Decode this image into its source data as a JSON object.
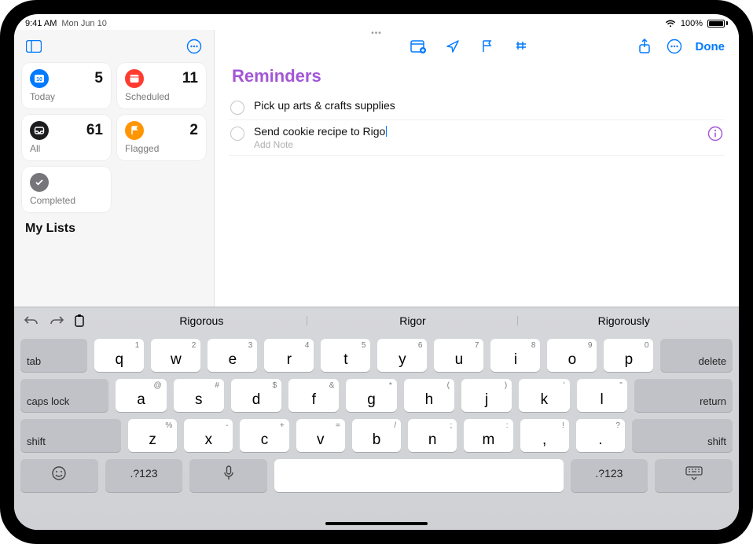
{
  "status": {
    "time": "9:41 AM",
    "date": "Mon Jun 10",
    "battery_percent": "100%"
  },
  "sidebar": {
    "cards": {
      "today": {
        "label": "Today",
        "count": "5"
      },
      "scheduled": {
        "label": "Scheduled",
        "count": "11"
      },
      "all": {
        "label": "All",
        "count": "61"
      },
      "flagged": {
        "label": "Flagged",
        "count": "2"
      },
      "completed": {
        "label": "Completed"
      }
    },
    "my_lists_heading": "My Lists"
  },
  "main": {
    "title": "Reminders",
    "done_label": "Done",
    "reminders": [
      {
        "text": "Pick up arts & crafts supplies"
      },
      {
        "text": "Send cookie recipe to Rigo",
        "note_placeholder": "Add Note"
      }
    ]
  },
  "keyboard": {
    "suggestions": [
      "Rigorous",
      "Rigor",
      "Rigorously"
    ],
    "row1": [
      {
        "k": "q",
        "s": "1"
      },
      {
        "k": "w",
        "s": "2"
      },
      {
        "k": "e",
        "s": "3"
      },
      {
        "k": "r",
        "s": "4"
      },
      {
        "k": "t",
        "s": "5"
      },
      {
        "k": "y",
        "s": "6"
      },
      {
        "k": "u",
        "s": "7"
      },
      {
        "k": "i",
        "s": "8"
      },
      {
        "k": "o",
        "s": "9"
      },
      {
        "k": "p",
        "s": "0"
      }
    ],
    "row2": [
      {
        "k": "a",
        "s": "@"
      },
      {
        "k": "s",
        "s": "#"
      },
      {
        "k": "d",
        "s": "$"
      },
      {
        "k": "f",
        "s": "&"
      },
      {
        "k": "g",
        "s": "*"
      },
      {
        "k": "h",
        "s": "("
      },
      {
        "k": "j",
        "s": ")"
      },
      {
        "k": "k",
        "s": "'"
      },
      {
        "k": "l",
        "s": "\""
      }
    ],
    "row3": [
      {
        "k": "z",
        "s": "%"
      },
      {
        "k": "x",
        "s": "-"
      },
      {
        "k": "c",
        "s": "+"
      },
      {
        "k": "v",
        "s": "="
      },
      {
        "k": "b",
        "s": "/"
      },
      {
        "k": "n",
        "s": ";"
      },
      {
        "k": "m",
        "s": ":"
      },
      {
        "k": ",",
        "s": "!"
      },
      {
        "k": ".",
        "s": "?"
      }
    ],
    "func": {
      "tab": "tab",
      "delete": "delete",
      "caps": "caps lock",
      "return": "return",
      "shift": "shift",
      "num": ".?123"
    }
  }
}
